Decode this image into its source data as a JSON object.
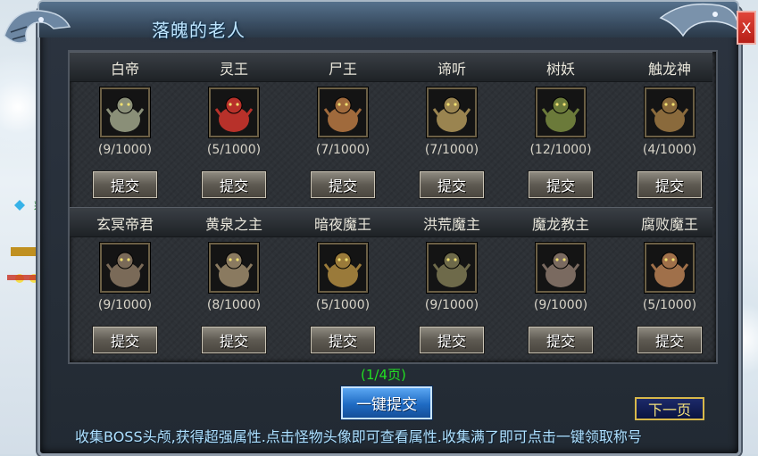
{
  "window": {
    "title": "落魄的老人",
    "close_label": "X"
  },
  "bosses_row1": [
    {
      "name": "白帝",
      "count": "(9/1000)",
      "submit": "提交",
      "color": "#8a8f78"
    },
    {
      "name": "灵王",
      "count": "(5/1000)",
      "submit": "提交",
      "color": "#b8312a"
    },
    {
      "name": "尸王",
      "count": "(7/1000)",
      "submit": "提交",
      "color": "#a06a3c"
    },
    {
      "name": "谛听",
      "count": "(7/1000)",
      "submit": "提交",
      "color": "#9a8450"
    },
    {
      "name": "树妖",
      "count": "(12/1000)",
      "submit": "提交",
      "color": "#6b7a3a"
    },
    {
      "name": "触龙神",
      "count": "(4/1000)",
      "submit": "提交",
      "color": "#8a6a3c"
    }
  ],
  "bosses_row2": [
    {
      "name": "玄冥帝君",
      "count": "(9/1000)",
      "submit": "提交",
      "color": "#7a6a58"
    },
    {
      "name": "黄泉之主",
      "count": "(8/1000)",
      "submit": "提交",
      "color": "#8a7a60"
    },
    {
      "name": "暗夜魔王",
      "count": "(5/1000)",
      "submit": "提交",
      "color": "#9a7a3a"
    },
    {
      "name": "洪荒魔主",
      "count": "(9/1000)",
      "submit": "提交",
      "color": "#6e6a4a"
    },
    {
      "name": "魔龙教主",
      "count": "(9/1000)",
      "submit": "提交",
      "color": "#7a6a60"
    },
    {
      "name": "腐败魔王",
      "count": "(5/1000)",
      "submit": "提交",
      "color": "#a0704a"
    }
  ],
  "pagination": {
    "indicator": "(1/4页)",
    "next_label": "下一页"
  },
  "actions": {
    "one_key_submit": "一键提交"
  },
  "footer": {
    "hint": "收集BOSS头颅,获得超强属性.点击怪物头像即可查看属性.收集满了即可点击一键领取称号"
  },
  "background": {
    "npc_name": "彩"
  }
}
